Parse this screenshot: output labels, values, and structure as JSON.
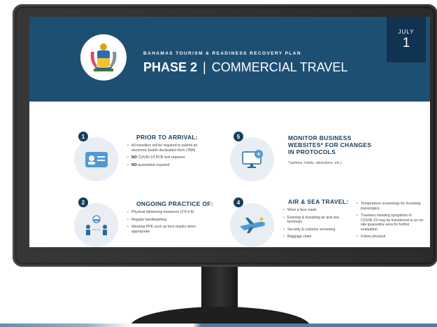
{
  "header": {
    "plan_title": "BAHAMAS TOURISM & READINESS RECOVERY PLAN",
    "phase": "PHASE 2",
    "separator": "|",
    "subtitle": "COMMERCIAL TRAVEL",
    "date_month": "JULY",
    "date_day": "1"
  },
  "sections": {
    "s1": {
      "number": "1",
      "title": "PRIOR TO ARRIVAL:",
      "bullets": [
        "All travellers will be required to submit an electronic health declaration form (TBA)",
        "COVID-19 PCR test required",
        "quarantine required"
      ],
      "bold_prefixes": [
        "NO",
        "NO"
      ]
    },
    "s5": {
      "number": "5",
      "title": "MONITOR BUSINESS WEBSITES* FOR CHANGES IN PROTOCOLS",
      "note": "*(airlines, hotels, attractions, etc.)"
    },
    "s2": {
      "number": "2",
      "title": "ONGOING PRACTICE OF:",
      "bullets": [
        "Physical distancing measures (3 ft-6 ft)",
        "Regular handwashing",
        "Wearing PPE such as face masks when appropriate"
      ]
    },
    "s4": {
      "number": "4",
      "title": "AIR & SEA TRAVEL:",
      "bullets_left": [
        "Wear a face mask",
        "Entering & transiting air and sea terminals",
        "Security & customs screening",
        "Baggage claim"
      ],
      "bullets_right": [
        "Temperature screenings for incoming passengers",
        "Travelers showing symptoms of COVID-19 may be transferred to an on-site quarantine area for further evaluation",
        "Follow physical"
      ]
    }
  },
  "colors": {
    "header_bg": "#1d4f73",
    "accent": "#163e5e",
    "bezel": "#2b2b2b"
  }
}
